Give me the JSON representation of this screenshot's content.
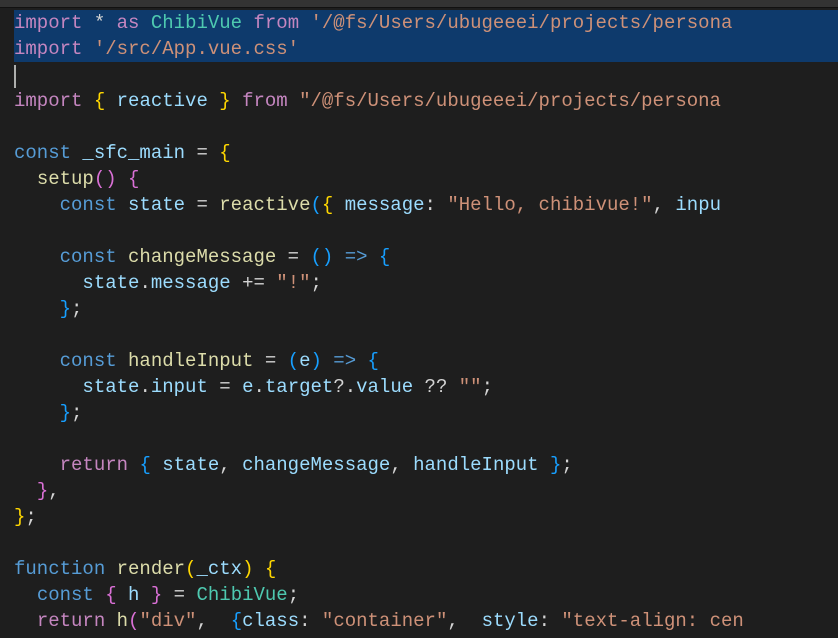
{
  "code": {
    "lines": [
      [
        {
          "t": "keyword",
          "v": "import"
        },
        {
          "t": "operator",
          "v": " * "
        },
        {
          "t": "keyword",
          "v": "as"
        },
        {
          "t": "ident",
          "v": " "
        },
        {
          "t": "type",
          "v": "ChibiVue"
        },
        {
          "t": "ident",
          "v": " "
        },
        {
          "t": "keyword",
          "v": "from"
        },
        {
          "t": "ident",
          "v": " "
        },
        {
          "t": "string",
          "v": "'/@fs/Users/ubugeeei/projects/persona"
        }
      ],
      [
        {
          "t": "keyword",
          "v": "import"
        },
        {
          "t": "ident",
          "v": " "
        },
        {
          "t": "string",
          "v": "'/src/App.vue.css'"
        }
      ],
      [
        {
          "t": "cursor",
          "v": ""
        }
      ],
      [
        {
          "t": "keyword",
          "v": "import"
        },
        {
          "t": "ident",
          "v": " "
        },
        {
          "t": "paren",
          "v": "{"
        },
        {
          "t": "ident",
          "v": " "
        },
        {
          "t": "property",
          "v": "reactive"
        },
        {
          "t": "ident",
          "v": " "
        },
        {
          "t": "paren",
          "v": "}"
        },
        {
          "t": "ident",
          "v": " "
        },
        {
          "t": "keyword",
          "v": "from"
        },
        {
          "t": "ident",
          "v": " "
        },
        {
          "t": "string",
          "v": "\"/@fs/Users/ubugeeei/projects/persona"
        }
      ],
      [],
      [
        {
          "t": "const",
          "v": "const"
        },
        {
          "t": "ident",
          "v": " "
        },
        {
          "t": "property",
          "v": "_sfc_main"
        },
        {
          "t": "ident",
          "v": " "
        },
        {
          "t": "operator",
          "v": "="
        },
        {
          "t": "ident",
          "v": " "
        },
        {
          "t": "paren",
          "v": "{"
        }
      ],
      [
        {
          "t": "ident",
          "v": "  "
        },
        {
          "t": "funcdecl",
          "v": "setup"
        },
        {
          "t": "paren2",
          "v": "()"
        },
        {
          "t": "ident",
          "v": " "
        },
        {
          "t": "paren2",
          "v": "{"
        }
      ],
      [
        {
          "t": "ident",
          "v": "    "
        },
        {
          "t": "const",
          "v": "const"
        },
        {
          "t": "ident",
          "v": " "
        },
        {
          "t": "property",
          "v": "state"
        },
        {
          "t": "ident",
          "v": " "
        },
        {
          "t": "operator",
          "v": "="
        },
        {
          "t": "ident",
          "v": " "
        },
        {
          "t": "func",
          "v": "reactive"
        },
        {
          "t": "paren3",
          "v": "("
        },
        {
          "t": "paren",
          "v": "{"
        },
        {
          "t": "ident",
          "v": " "
        },
        {
          "t": "property",
          "v": "message"
        },
        {
          "t": "punct",
          "v": ":"
        },
        {
          "t": "ident",
          "v": " "
        },
        {
          "t": "string",
          "v": "\"Hello, chibivue!\""
        },
        {
          "t": "punct",
          "v": ","
        },
        {
          "t": "ident",
          "v": " "
        },
        {
          "t": "property",
          "v": "inpu"
        }
      ],
      [],
      [
        {
          "t": "ident",
          "v": "    "
        },
        {
          "t": "const",
          "v": "const"
        },
        {
          "t": "ident",
          "v": " "
        },
        {
          "t": "funcdecl",
          "v": "changeMessage"
        },
        {
          "t": "ident",
          "v": " "
        },
        {
          "t": "operator",
          "v": "="
        },
        {
          "t": "ident",
          "v": " "
        },
        {
          "t": "paren3",
          "v": "()"
        },
        {
          "t": "ident",
          "v": " "
        },
        {
          "t": "const",
          "v": "=>"
        },
        {
          "t": "ident",
          "v": " "
        },
        {
          "t": "paren3",
          "v": "{"
        }
      ],
      [
        {
          "t": "ident",
          "v": "      "
        },
        {
          "t": "property",
          "v": "state"
        },
        {
          "t": "punct",
          "v": "."
        },
        {
          "t": "property",
          "v": "message"
        },
        {
          "t": "ident",
          "v": " "
        },
        {
          "t": "operator",
          "v": "+="
        },
        {
          "t": "ident",
          "v": " "
        },
        {
          "t": "string",
          "v": "\"!\""
        },
        {
          "t": "punct",
          "v": ";"
        }
      ],
      [
        {
          "t": "ident",
          "v": "    "
        },
        {
          "t": "paren3",
          "v": "}"
        },
        {
          "t": "punct",
          "v": ";"
        }
      ],
      [],
      [
        {
          "t": "ident",
          "v": "    "
        },
        {
          "t": "const",
          "v": "const"
        },
        {
          "t": "ident",
          "v": " "
        },
        {
          "t": "funcdecl",
          "v": "handleInput"
        },
        {
          "t": "ident",
          "v": " "
        },
        {
          "t": "operator",
          "v": "="
        },
        {
          "t": "ident",
          "v": " "
        },
        {
          "t": "paren3",
          "v": "("
        },
        {
          "t": "param",
          "v": "e"
        },
        {
          "t": "paren3",
          "v": ")"
        },
        {
          "t": "ident",
          "v": " "
        },
        {
          "t": "const",
          "v": "=>"
        },
        {
          "t": "ident",
          "v": " "
        },
        {
          "t": "paren3",
          "v": "{"
        }
      ],
      [
        {
          "t": "ident",
          "v": "      "
        },
        {
          "t": "property",
          "v": "state"
        },
        {
          "t": "punct",
          "v": "."
        },
        {
          "t": "property",
          "v": "input"
        },
        {
          "t": "ident",
          "v": " "
        },
        {
          "t": "operator",
          "v": "="
        },
        {
          "t": "ident",
          "v": " "
        },
        {
          "t": "property",
          "v": "e"
        },
        {
          "t": "punct",
          "v": "."
        },
        {
          "t": "property",
          "v": "target"
        },
        {
          "t": "punct",
          "v": "?."
        },
        {
          "t": "property",
          "v": "value"
        },
        {
          "t": "ident",
          "v": " "
        },
        {
          "t": "operator",
          "v": "??"
        },
        {
          "t": "ident",
          "v": " "
        },
        {
          "t": "string",
          "v": "\"\""
        },
        {
          "t": "punct",
          "v": ";"
        }
      ],
      [
        {
          "t": "ident",
          "v": "    "
        },
        {
          "t": "paren3",
          "v": "}"
        },
        {
          "t": "punct",
          "v": ";"
        }
      ],
      [],
      [
        {
          "t": "ident",
          "v": "    "
        },
        {
          "t": "return",
          "v": "return"
        },
        {
          "t": "ident",
          "v": " "
        },
        {
          "t": "paren3",
          "v": "{"
        },
        {
          "t": "ident",
          "v": " "
        },
        {
          "t": "property",
          "v": "state"
        },
        {
          "t": "punct",
          "v": ","
        },
        {
          "t": "ident",
          "v": " "
        },
        {
          "t": "property",
          "v": "changeMessage"
        },
        {
          "t": "punct",
          "v": ","
        },
        {
          "t": "ident",
          "v": " "
        },
        {
          "t": "property",
          "v": "handleInput"
        },
        {
          "t": "ident",
          "v": " "
        },
        {
          "t": "paren3",
          "v": "}"
        },
        {
          "t": "punct",
          "v": ";"
        }
      ],
      [
        {
          "t": "ident",
          "v": "  "
        },
        {
          "t": "paren2",
          "v": "}"
        },
        {
          "t": "punct",
          "v": ","
        }
      ],
      [
        {
          "t": "paren",
          "v": "}"
        },
        {
          "t": "punct",
          "v": ";"
        }
      ],
      [],
      [
        {
          "t": "const",
          "v": "function"
        },
        {
          "t": "ident",
          "v": " "
        },
        {
          "t": "funcdecl",
          "v": "render"
        },
        {
          "t": "paren",
          "v": "("
        },
        {
          "t": "param",
          "v": "_ctx"
        },
        {
          "t": "paren",
          "v": ")"
        },
        {
          "t": "ident",
          "v": " "
        },
        {
          "t": "paren",
          "v": "{"
        }
      ],
      [
        {
          "t": "ident",
          "v": "  "
        },
        {
          "t": "const",
          "v": "const"
        },
        {
          "t": "ident",
          "v": " "
        },
        {
          "t": "paren2",
          "v": "{"
        },
        {
          "t": "ident",
          "v": " "
        },
        {
          "t": "property",
          "v": "h"
        },
        {
          "t": "ident",
          "v": " "
        },
        {
          "t": "paren2",
          "v": "}"
        },
        {
          "t": "ident",
          "v": " "
        },
        {
          "t": "operator",
          "v": "="
        },
        {
          "t": "ident",
          "v": " "
        },
        {
          "t": "type",
          "v": "ChibiVue"
        },
        {
          "t": "punct",
          "v": ";"
        }
      ],
      [
        {
          "t": "ident",
          "v": "  "
        },
        {
          "t": "return",
          "v": "return"
        },
        {
          "t": "ident",
          "v": " "
        },
        {
          "t": "func",
          "v": "h"
        },
        {
          "t": "paren2",
          "v": "("
        },
        {
          "t": "string",
          "v": "\"div\""
        },
        {
          "t": "punct",
          "v": ","
        },
        {
          "t": "ident",
          "v": "  "
        },
        {
          "t": "paren3",
          "v": "{"
        },
        {
          "t": "property",
          "v": "class"
        },
        {
          "t": "punct",
          "v": ":"
        },
        {
          "t": "ident",
          "v": " "
        },
        {
          "t": "string",
          "v": "\"container\""
        },
        {
          "t": "punct",
          "v": ","
        },
        {
          "t": "ident",
          "v": "  "
        },
        {
          "t": "property",
          "v": "style"
        },
        {
          "t": "punct",
          "v": ":"
        },
        {
          "t": "ident",
          "v": " "
        },
        {
          "t": "string",
          "v": "\"text-align: cen"
        }
      ]
    ],
    "highlightedLines": [
      0,
      1
    ]
  }
}
